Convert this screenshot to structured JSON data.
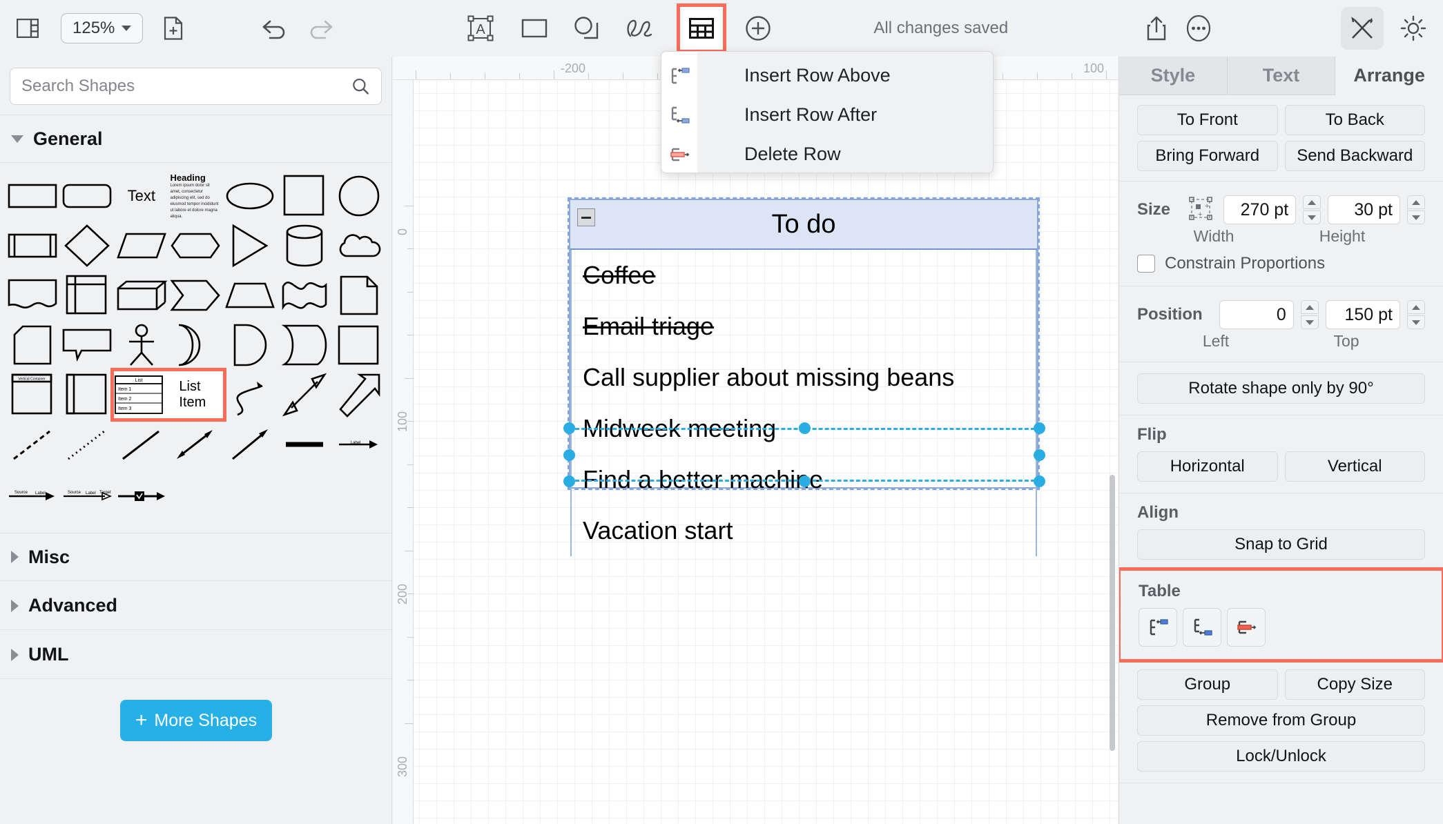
{
  "toolbar": {
    "panel_toggle_icon": "sidebar-toggle-icon",
    "zoom_value": "125%",
    "new_page_icon": "new-page-icon",
    "undo_icon": "undo-icon",
    "redo_icon": "redo-icon",
    "text_tool_icon": "text-box-icon",
    "rect_tool_icon": "rectangle-icon",
    "shape_tool_icon": "shapes-icon",
    "freehand_tool_icon": "freehand-icon",
    "table_tool_icon": "table-icon",
    "add_tool_icon": "plus-circle-icon",
    "status": "All changes saved",
    "share_icon": "share-icon",
    "more_icon": "more-options-icon",
    "format_icon": "format-panel-icon",
    "theme_icon": "appearance-icon"
  },
  "row_menu": {
    "items": [
      {
        "label": "Insert Row Above",
        "icon": "insert-row-above-icon"
      },
      {
        "label": "Insert Row After",
        "icon": "insert-row-after-icon"
      },
      {
        "label": "Delete Row",
        "icon": "delete-row-icon"
      }
    ]
  },
  "shapes_panel": {
    "search": {
      "placeholder": "Search Shapes",
      "value": "",
      "icon": "search-icon"
    },
    "sections": [
      {
        "label": "General",
        "expanded": true
      },
      {
        "label": "Misc",
        "expanded": false
      },
      {
        "label": "Advanced",
        "expanded": false
      },
      {
        "label": "UML",
        "expanded": false
      }
    ],
    "shapes": [
      "rectangle",
      "rounded-rectangle",
      "text",
      "textbox-heading",
      "ellipse",
      "square",
      "circle",
      "process",
      "diamond",
      "parallelogram",
      "hexagon",
      "triangle",
      "cylinder",
      "cloud",
      "document",
      "internal-storage",
      "cube",
      "step",
      "trapezoid",
      "tape",
      "note",
      "card",
      "callout",
      "actor",
      "delay",
      "half-circle",
      "or-shape",
      "double-rectangle",
      "container",
      "vertical-container",
      "list",
      "list-item",
      "curve-arrow",
      "bidirectional-arrow",
      "block-arrow",
      "dashed-line",
      "dotted-line",
      "plain-line",
      "bidirectional-line",
      "single-arrow-line",
      "bold-line",
      "labeled-arrow",
      "source-target-arrow",
      "source-target-label-arrow",
      "checkbox-arrow"
    ],
    "list_shape_label": "List",
    "list_shape_items": [
      "Item 1",
      "Item 2",
      "Item 3"
    ],
    "list_item_label": "List Item",
    "palette_text_label": "Text",
    "palette_heading_label": "Heading",
    "more_shapes_label": "More Shapes",
    "more_shapes_color": "#25b0e8"
  },
  "canvas": {
    "ruler_h_labels": [
      "-200",
      "100"
    ],
    "ruler_v_labels": [
      "0",
      "100",
      "200",
      "300"
    ],
    "table": {
      "title": "To do",
      "collapse_icon": "collapse-minus-icon",
      "header_fill": "#dbe5f6",
      "rows": [
        {
          "text": "Coffee",
          "done": true,
          "selected": false
        },
        {
          "text": "Email triage",
          "done": true,
          "selected": false
        },
        {
          "text": "Call supplier about missing beans",
          "done": false,
          "selected": false
        },
        {
          "text": "Midweek meeting",
          "done": false,
          "selected": false
        },
        {
          "text": "Find a better machine",
          "done": false,
          "selected": true
        },
        {
          "text": "Vacation start",
          "done": false,
          "selected": false
        }
      ],
      "selection_color": "#2aade3"
    }
  },
  "right_panel": {
    "tabs": [
      {
        "label": "Style",
        "active": false
      },
      {
        "label": "Text",
        "active": false
      },
      {
        "label": "Arrange",
        "active": true
      }
    ],
    "order_buttons": [
      "To Front",
      "To Back",
      "Bring Forward",
      "Send Backward"
    ],
    "size": {
      "label": "Size",
      "autosize_icon": "autosize-icon",
      "width_value": "270 pt",
      "height_value": "30 pt",
      "width_label": "Width",
      "height_label": "Height",
      "constrain_label": "Constrain Proportions",
      "constrain_checked": false
    },
    "position": {
      "label": "Position",
      "left_value": "0",
      "top_value": "150 pt",
      "left_label": "Left",
      "top_label": "Top"
    },
    "rotate_label": "Rotate shape only by 90°",
    "flip": {
      "label": "Flip",
      "buttons": [
        "Horizontal",
        "Vertical"
      ]
    },
    "align": {
      "label": "Align",
      "buttons": [
        "Snap to Grid"
      ]
    },
    "table": {
      "label": "Table",
      "buttons": [
        {
          "icon": "insert-row-above-icon"
        },
        {
          "icon": "insert-row-after-icon"
        },
        {
          "icon": "delete-row-icon"
        }
      ],
      "highlight_color": "#fa6b5a"
    },
    "group_buttons": [
      "Group",
      "Copy Size",
      "Remove from Group",
      "Lock/Unlock"
    ]
  }
}
